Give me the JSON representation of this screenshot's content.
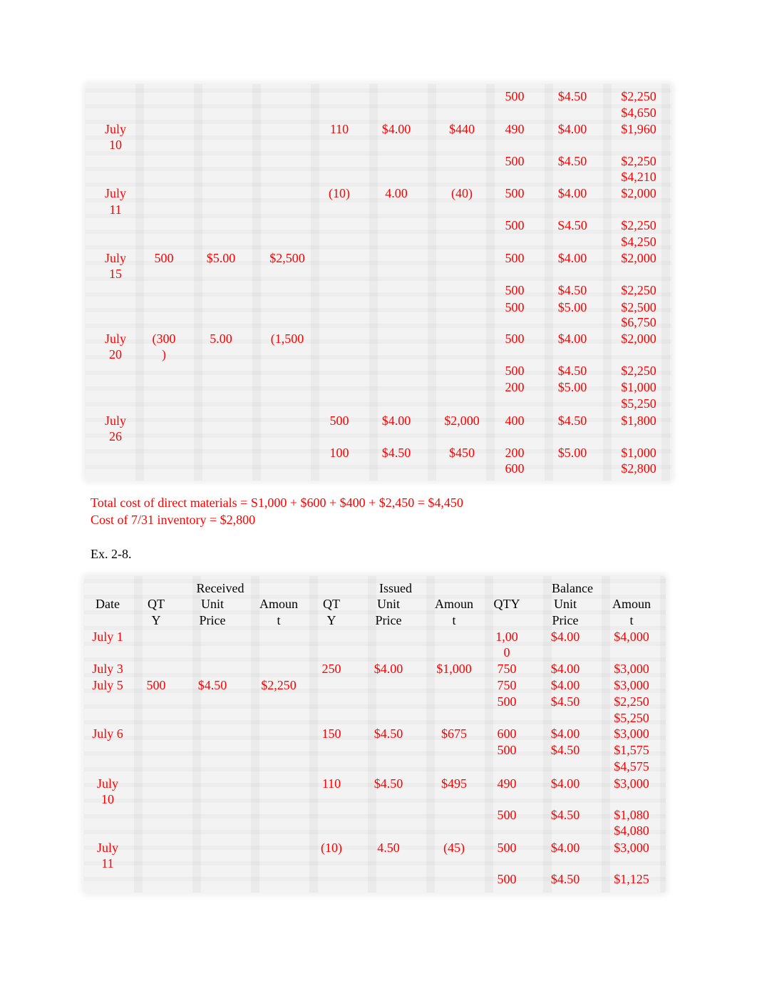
{
  "table1": {
    "rows": [
      {
        "date": "",
        "rq": "",
        "rp": "",
        "ra": "",
        "iq": "",
        "ip": "",
        "ia": "",
        "bq": "500",
        "bp": "$4.50",
        "ba": "$2,250"
      },
      {
        "date": "",
        "rq": "",
        "rp": "",
        "ra": "",
        "iq": "",
        "ip": "",
        "ia": "",
        "bq": "",
        "bp": "",
        "ba": "$4,650"
      },
      {
        "date": "July",
        "rq": "",
        "rp": "",
        "ra": "",
        "iq": "110",
        "ip": "$4.00",
        "ia": "$440",
        "bq": "490",
        "bp": "$4.00",
        "ba": "$1,960"
      },
      {
        "date": "10",
        "rq": "",
        "rp": "",
        "ra": "",
        "iq": "",
        "ip": "",
        "ia": "",
        "bq": "",
        "bp": "",
        "ba": ""
      },
      {
        "date": "",
        "rq": "",
        "rp": "",
        "ra": "",
        "iq": "",
        "ip": "",
        "ia": "",
        "bq": "500",
        "bp": "$4.50",
        "ba": "$2,250"
      },
      {
        "date": "",
        "rq": "",
        "rp": "",
        "ra": "",
        "iq": "",
        "ip": "",
        "ia": "",
        "bq": "",
        "bp": "",
        "ba": "$4,210"
      },
      {
        "date": "July",
        "rq": "",
        "rp": "",
        "ra": "",
        "iq": "(10)",
        "ip": "4.00",
        "ia": "(40)",
        "bq": "500",
        "bp": "$4.00",
        "ba": "$2,000"
      },
      {
        "date": "11",
        "rq": "",
        "rp": "",
        "ra": "",
        "iq": "",
        "ip": "",
        "ia": "",
        "bq": "",
        "bp": "",
        "ba": ""
      },
      {
        "date": "",
        "rq": "",
        "rp": "",
        "ra": "",
        "iq": "",
        "ip": "",
        "ia": "",
        "bq": "500",
        "bp": "S4.50",
        "ba": "$2,250"
      },
      {
        "date": "",
        "rq": "",
        "rp": "",
        "ra": "",
        "iq": "",
        "ip": "",
        "ia": "",
        "bq": "",
        "bp": "",
        "ba": "$4,250"
      },
      {
        "date": "July",
        "rq": "500",
        "rp": "$5.00",
        "ra": "$2,500",
        "iq": "",
        "ip": "",
        "ia": "",
        "bq": "500",
        "bp": "$4.00",
        "ba": "$2,000"
      },
      {
        "date": "15",
        "rq": "",
        "rp": "",
        "ra": "",
        "iq": "",
        "ip": "",
        "ia": "",
        "bq": "",
        "bp": "",
        "ba": ""
      },
      {
        "date": "",
        "rq": "",
        "rp": "",
        "ra": "",
        "iq": "",
        "ip": "",
        "ia": "",
        "bq": "500",
        "bp": "$4.50",
        "ba": "$2,250"
      },
      {
        "date": "",
        "rq": "",
        "rp": "",
        "ra": "",
        "iq": "",
        "ip": "",
        "ia": "",
        "bq": "500",
        "bp": "$5.00",
        "ba": "$2,500"
      },
      {
        "date": "",
        "rq": "",
        "rp": "",
        "ra": "",
        "iq": "",
        "ip": "",
        "ia": "",
        "bq": "",
        "bp": "",
        "ba": "$6,750"
      },
      {
        "date": "July",
        "rq": "(300",
        "rp": "5.00",
        "ra": "(1,500",
        "iq": "",
        "ip": "",
        "ia": "",
        "bq": "500",
        "bp": "$4.00",
        "ba": "$2,000"
      },
      {
        "date": "20",
        "rq": ")",
        "rp": "",
        "ra": "",
        "iq": "",
        "ip": "",
        "ia": "",
        "bq": "",
        "bp": "",
        "ba": ""
      },
      {
        "date": "",
        "rq": "",
        "rp": "",
        "ra": "",
        "iq": "",
        "ip": "",
        "ia": "",
        "bq": "500",
        "bp": "$4.50",
        "ba": "$2,250"
      },
      {
        "date": "",
        "rq": "",
        "rp": "",
        "ra": "",
        "iq": "",
        "ip": "",
        "ia": "",
        "bq": "200",
        "bp": "$5.00",
        "ba": "$1,000"
      },
      {
        "date": "",
        "rq": "",
        "rp": "",
        "ra": "",
        "iq": "",
        "ip": "",
        "ia": "",
        "bq": "",
        "bp": "",
        "ba": "$5,250"
      },
      {
        "date": "July",
        "rq": "",
        "rp": "",
        "ra": "",
        "iq": "500",
        "ip": "$4.00",
        "ia": "$2,000",
        "bq": "400",
        "bp": "$4.50",
        "ba": "$1,800"
      },
      {
        "date": "26",
        "rq": "",
        "rp": "",
        "ra": "",
        "iq": "",
        "ip": "",
        "ia": "",
        "bq": "",
        "bp": "",
        "ba": ""
      },
      {
        "date": "",
        "rq": "",
        "rp": "",
        "ra": "",
        "iq": "100",
        "ip": "$4.50",
        "ia": "$450",
        "bq": "200",
        "bp": "$5.00",
        "ba": "$1,000"
      },
      {
        "date": "",
        "rq": "",
        "rp": "",
        "ra": "",
        "iq": "",
        "ip": "",
        "ia": "",
        "bq": "600",
        "bp": "",
        "ba": "$2,800"
      }
    ]
  },
  "notes": {
    "total_cost": "Total cost of direct materials = S1,000 + $600 + $400 + $2,450 = $4,450",
    "inventory_cost": "Cost of 7/31 inventory = $2,800"
  },
  "exercise_heading": "Ex. 2-8.",
  "table2": {
    "group_headers": {
      "received": "Received",
      "issued": "Issued",
      "balance": "Balance"
    },
    "header_rows": [
      {
        "date": "Date",
        "rq": "QT",
        "rp": "Unit",
        "ra": "Amoun",
        "iq": "QT",
        "ip": "Unit",
        "ia": "Amoun",
        "bq": "QTY",
        "bp": "Unit",
        "ba": "Amoun"
      },
      {
        "date": "",
        "rq": "Y",
        "rp": "Price",
        "ra": "t",
        "iq": "Y",
        "ip": "Price",
        "ia": "t",
        "bq": "",
        "bp": "Price",
        "ba": "t"
      }
    ],
    "rows": [
      {
        "date": "July 1",
        "rq": "",
        "rp": "",
        "ra": "",
        "iq": "",
        "ip": "",
        "ia": "",
        "bq": "1,00",
        "bp": "$4.00",
        "ba": "$4,000"
      },
      {
        "date": "",
        "rq": "",
        "rp": "",
        "ra": "",
        "iq": "",
        "ip": "",
        "ia": "",
        "bq": "0",
        "bp": "",
        "ba": ""
      },
      {
        "date": "July 3",
        "rq": "",
        "rp": "",
        "ra": "",
        "iq": "250",
        "ip": "$4.00",
        "ia": "$1,000",
        "bq": "750",
        "bp": "$4.00",
        "ba": "$3,000"
      },
      {
        "date": "July 5",
        "rq": "500",
        "rp": "$4.50",
        "ra": "$2,250",
        "iq": "",
        "ip": "",
        "ia": "",
        "bq": "750",
        "bp": "$4.00",
        "ba": "$3,000"
      },
      {
        "date": "",
        "rq": "",
        "rp": "",
        "ra": "",
        "iq": "",
        "ip": "",
        "ia": "",
        "bq": "500",
        "bp": "$4.50",
        "ba": "$2,250"
      },
      {
        "date": "",
        "rq": "",
        "rp": "",
        "ra": "",
        "iq": "",
        "ip": "",
        "ia": "",
        "bq": "",
        "bp": "",
        "ba": "$5,250"
      },
      {
        "date": "July 6",
        "rq": "",
        "rp": "",
        "ra": "",
        "iq": "150",
        "ip": "$4.50",
        "ia": "$675",
        "bq": "600",
        "bp": "$4.00",
        "ba": "$3,000"
      },
      {
        "date": "",
        "rq": "",
        "rp": "",
        "ra": "",
        "iq": "",
        "ip": "",
        "ia": "",
        "bq": "500",
        "bp": "$4.50",
        "ba": "$1,575"
      },
      {
        "date": "",
        "rq": "",
        "rp": "",
        "ra": "",
        "iq": "",
        "ip": "",
        "ia": "",
        "bq": "",
        "bp": "",
        "ba": "$4,575"
      },
      {
        "date": "July",
        "rq": "",
        "rp": "",
        "ra": "",
        "iq": "110",
        "ip": "$4.50",
        "ia": "$495",
        "bq": "490",
        "bp": "$4.00",
        "ba": "$3,000"
      },
      {
        "date": "10",
        "rq": "",
        "rp": "",
        "ra": "",
        "iq": "",
        "ip": "",
        "ia": "",
        "bq": "",
        "bp": "",
        "ba": ""
      },
      {
        "date": "",
        "rq": "",
        "rp": "",
        "ra": "",
        "iq": "",
        "ip": "",
        "ia": "",
        "bq": "500",
        "bp": "$4.50",
        "ba": "$1,080"
      },
      {
        "date": "",
        "rq": "",
        "rp": "",
        "ra": "",
        "iq": "",
        "ip": "",
        "ia": "",
        "bq": "",
        "bp": "",
        "ba": "$4,080"
      },
      {
        "date": "July",
        "rq": "",
        "rp": "",
        "ra": "",
        "iq": "(10)",
        "ip": "4.50",
        "ia": "(45)",
        "bq": "500",
        "bp": "$4.00",
        "ba": "$3,000"
      },
      {
        "date": "11",
        "rq": "",
        "rp": "",
        "ra": "",
        "iq": "",
        "ip": "",
        "ia": "",
        "bq": "",
        "bp": "",
        "ba": ""
      },
      {
        "date": "",
        "rq": "",
        "rp": "",
        "ra": "",
        "iq": "",
        "ip": "",
        "ia": "",
        "bq": "500",
        "bp": "$4.50",
        "ba": "$1,125"
      }
    ]
  }
}
